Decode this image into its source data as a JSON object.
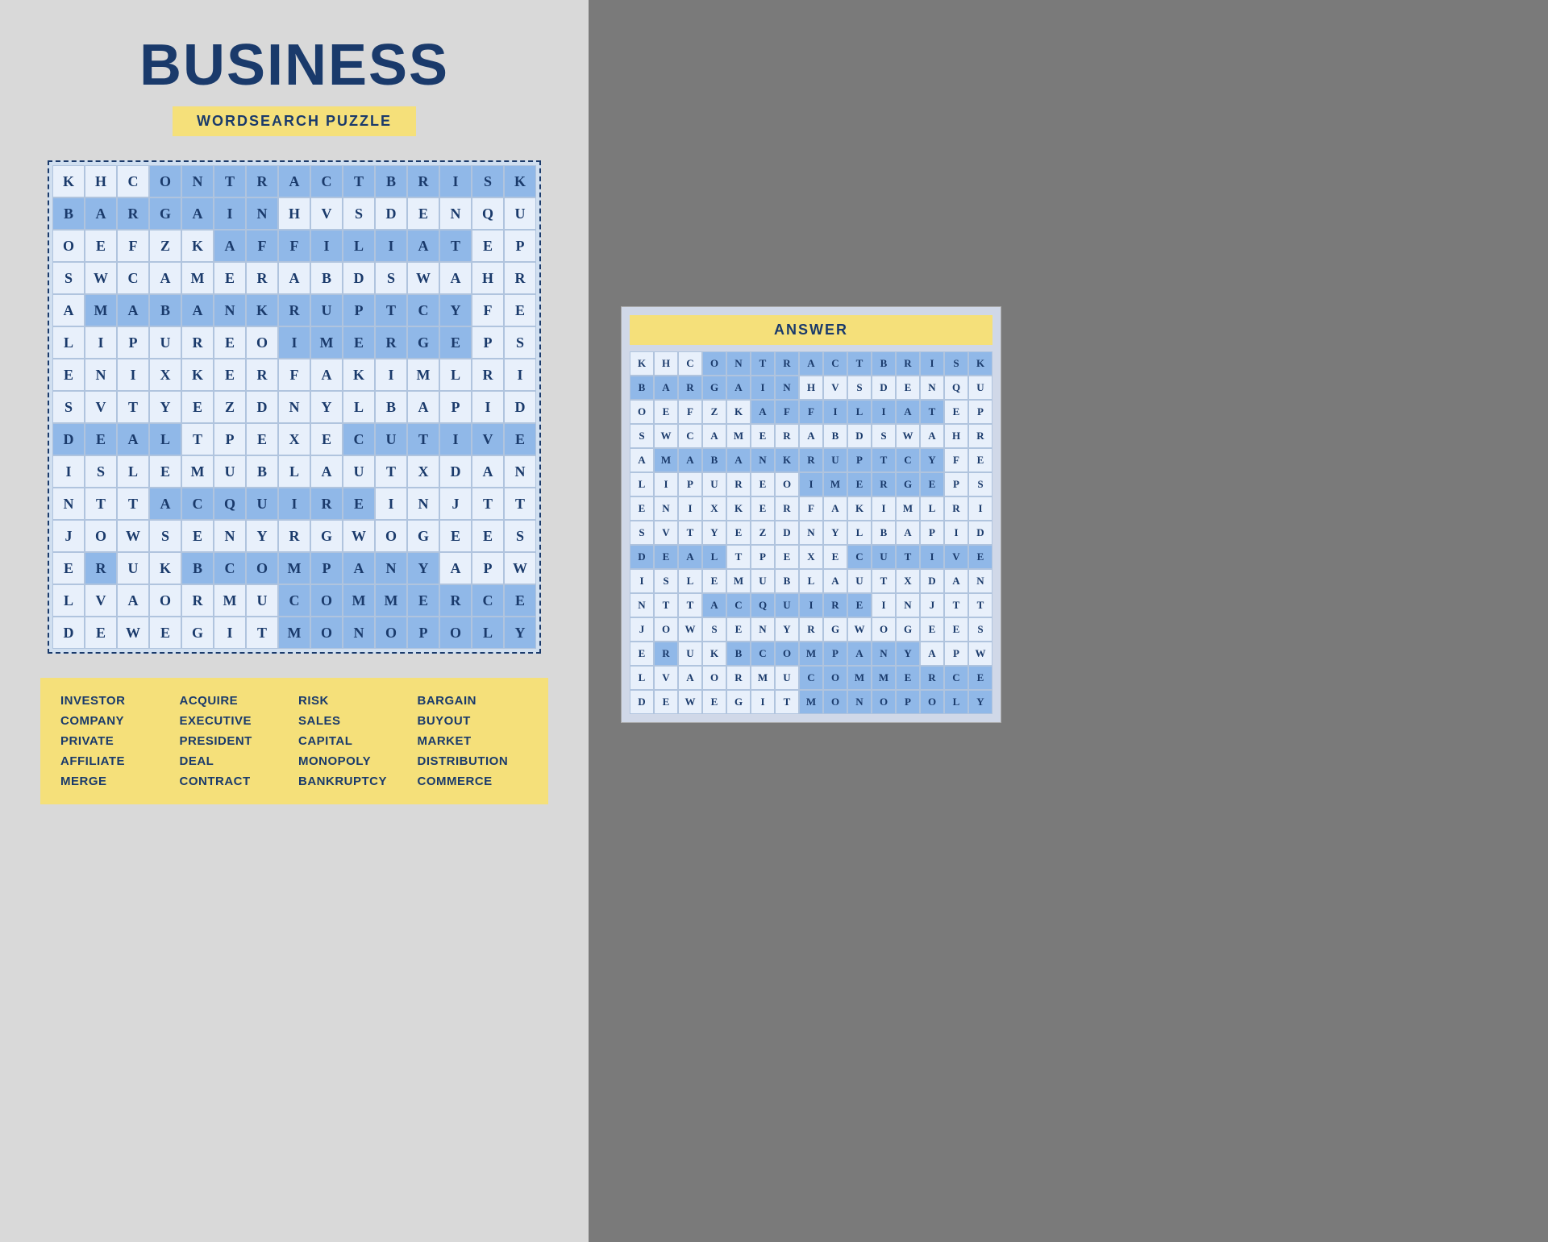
{
  "title": "BUSINESS",
  "subtitle": "WORDSEARCH PUZZLE",
  "answer_title": "ANSWER",
  "grid": [
    [
      "K",
      "H",
      "C",
      "O",
      "N",
      "T",
      "R",
      "A",
      "C",
      "T",
      "B",
      "R",
      "I",
      "S",
      "K"
    ],
    [
      "B",
      "A",
      "R",
      "G",
      "A",
      "I",
      "N",
      "H",
      "V",
      "S",
      "D",
      "E",
      "N",
      "Q",
      "U"
    ],
    [
      "O",
      "E",
      "F",
      "Z",
      "K",
      "A",
      "F",
      "F",
      "I",
      "L",
      "I",
      "A",
      "T",
      "E",
      "P"
    ],
    [
      "S",
      "W",
      "C",
      "A",
      "M",
      "E",
      "R",
      "A",
      "B",
      "D",
      "S",
      "W",
      "A",
      "H",
      "R"
    ],
    [
      "A",
      "M",
      "A",
      "B",
      "A",
      "N",
      "K",
      "R",
      "U",
      "P",
      "T",
      "C",
      "Y",
      "F",
      "E"
    ],
    [
      "L",
      "I",
      "P",
      "U",
      "R",
      "E",
      "O",
      "I",
      "M",
      "E",
      "R",
      "G",
      "E",
      "P",
      "S"
    ],
    [
      "E",
      "N",
      "I",
      "X",
      "K",
      "E",
      "R",
      "F",
      "A",
      "K",
      "I",
      "M",
      "L",
      "R",
      "I"
    ],
    [
      "S",
      "V",
      "T",
      "Y",
      "E",
      "Z",
      "D",
      "N",
      "Y",
      "L",
      "B",
      "A",
      "P",
      "I",
      "D"
    ],
    [
      "D",
      "E",
      "A",
      "L",
      "T",
      "P",
      "E",
      "X",
      "E",
      "C",
      "U",
      "T",
      "I",
      "V",
      "E"
    ],
    [
      "I",
      "S",
      "L",
      "E",
      "M",
      "U",
      "B",
      "L",
      "A",
      "U",
      "T",
      "X",
      "D",
      "A",
      "N"
    ],
    [
      "N",
      "T",
      "T",
      "A",
      "C",
      "Q",
      "U",
      "I",
      "R",
      "E",
      "I",
      "N",
      "J",
      "T",
      "T"
    ],
    [
      "J",
      "O",
      "W",
      "S",
      "E",
      "N",
      "Y",
      "R",
      "G",
      "W",
      "O",
      "G",
      "E",
      "E",
      "S"
    ],
    [
      "E",
      "R",
      "U",
      "K",
      "B",
      "C",
      "O",
      "M",
      "P",
      "A",
      "N",
      "Y",
      "A",
      "P",
      "W"
    ],
    [
      "L",
      "V",
      "A",
      "O",
      "R",
      "M",
      "U",
      "C",
      "O",
      "M",
      "M",
      "E",
      "R",
      "C",
      "E"
    ],
    [
      "D",
      "E",
      "W",
      "E",
      "G",
      "I",
      "T",
      "M",
      "O",
      "N",
      "O",
      "P",
      "O",
      "L",
      "Y"
    ]
  ],
  "highlights": [
    [
      0,
      3
    ],
    [
      0,
      4
    ],
    [
      0,
      5
    ],
    [
      0,
      6
    ],
    [
      0,
      7
    ],
    [
      0,
      8
    ],
    [
      0,
      9
    ],
    [
      0,
      10
    ],
    [
      0,
      11
    ],
    [
      0,
      12
    ],
    [
      0,
      13
    ],
    [
      0,
      14
    ],
    [
      1,
      0
    ],
    [
      1,
      1
    ],
    [
      1,
      2
    ],
    [
      1,
      3
    ],
    [
      1,
      4
    ],
    [
      1,
      5
    ],
    [
      1,
      6
    ],
    [
      2,
      5
    ],
    [
      2,
      6
    ],
    [
      2,
      7
    ],
    [
      2,
      8
    ],
    [
      2,
      9
    ],
    [
      2,
      10
    ],
    [
      2,
      11
    ],
    [
      2,
      12
    ],
    [
      4,
      1
    ],
    [
      4,
      2
    ],
    [
      4,
      3
    ],
    [
      4,
      4
    ],
    [
      4,
      5
    ],
    [
      4,
      6
    ],
    [
      4,
      7
    ],
    [
      4,
      8
    ],
    [
      4,
      9
    ],
    [
      4,
      10
    ],
    [
      4,
      11
    ],
    [
      4,
      12
    ],
    [
      5,
      7
    ],
    [
      5,
      8
    ],
    [
      5,
      9
    ],
    [
      5,
      10
    ],
    [
      5,
      11
    ],
    [
      5,
      12
    ],
    [
      8,
      0
    ],
    [
      8,
      1
    ],
    [
      8,
      2
    ],
    [
      8,
      3
    ],
    [
      8,
      9
    ],
    [
      8,
      10
    ],
    [
      8,
      11
    ],
    [
      8,
      12
    ],
    [
      8,
      13
    ],
    [
      8,
      14
    ],
    [
      10,
      3
    ],
    [
      10,
      4
    ],
    [
      10,
      5
    ],
    [
      10,
      6
    ],
    [
      10,
      7
    ],
    [
      10,
      8
    ],
    [
      10,
      9
    ],
    [
      12,
      1
    ],
    [
      12,
      4
    ],
    [
      12,
      5
    ],
    [
      12,
      6
    ],
    [
      12,
      7
    ],
    [
      12,
      8
    ],
    [
      12,
      9
    ],
    [
      12,
      10
    ],
    [
      12,
      11
    ],
    [
      13,
      7
    ],
    [
      13,
      8
    ],
    [
      13,
      9
    ],
    [
      13,
      10
    ],
    [
      13,
      11
    ],
    [
      13,
      12
    ],
    [
      13,
      13
    ],
    [
      13,
      14
    ],
    [
      14,
      7
    ],
    [
      14,
      8
    ],
    [
      14,
      9
    ],
    [
      14,
      10
    ],
    [
      14,
      11
    ],
    [
      14,
      12
    ],
    [
      14,
      13
    ],
    [
      14,
      14
    ]
  ],
  "words": [
    "INVESTOR",
    "ACQUIRE",
    "RISK",
    "BARGAIN",
    "COMPANY",
    "EXECUTIVE",
    "SALES",
    "BUYOUT",
    "PRIVATE",
    "PRESIDENT",
    "CAPITAL",
    "MARKET",
    "AFFILIATE",
    "DEAL",
    "MONOPOLY",
    "DISTRIBUTION",
    "MERGE",
    "CONTRACT",
    "BANKRUPTCY",
    "COMMERCE"
  ]
}
